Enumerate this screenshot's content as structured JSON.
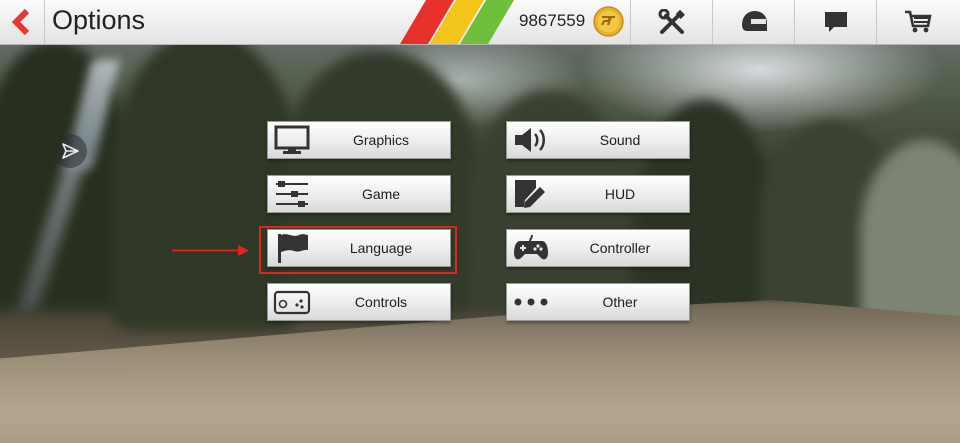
{
  "header": {
    "title": "Options",
    "coins": "9867559",
    "stripe_colors": [
      "#e8312b",
      "#f3c518",
      "#6fbf3d"
    ],
    "toolbar_icons": [
      "tools-icon",
      "helmet-icon",
      "chat-icon",
      "cart-icon"
    ]
  },
  "menu": {
    "left": [
      {
        "label": "Graphics",
        "icon": "monitor-icon"
      },
      {
        "label": "Game",
        "icon": "sliders-icon"
      },
      {
        "label": "Language",
        "icon": "flag-icon"
      },
      {
        "label": "Controls",
        "icon": "phone-controls-icon"
      }
    ],
    "right": [
      {
        "label": "Sound",
        "icon": "speaker-icon"
      },
      {
        "label": "HUD",
        "icon": "edit-icon"
      },
      {
        "label": "Controller",
        "icon": "gamepad-icon"
      },
      {
        "label": "Other",
        "icon": "more-dots-icon"
      }
    ]
  },
  "annotation": {
    "highlight_color": "#e02424",
    "target": "Language"
  }
}
